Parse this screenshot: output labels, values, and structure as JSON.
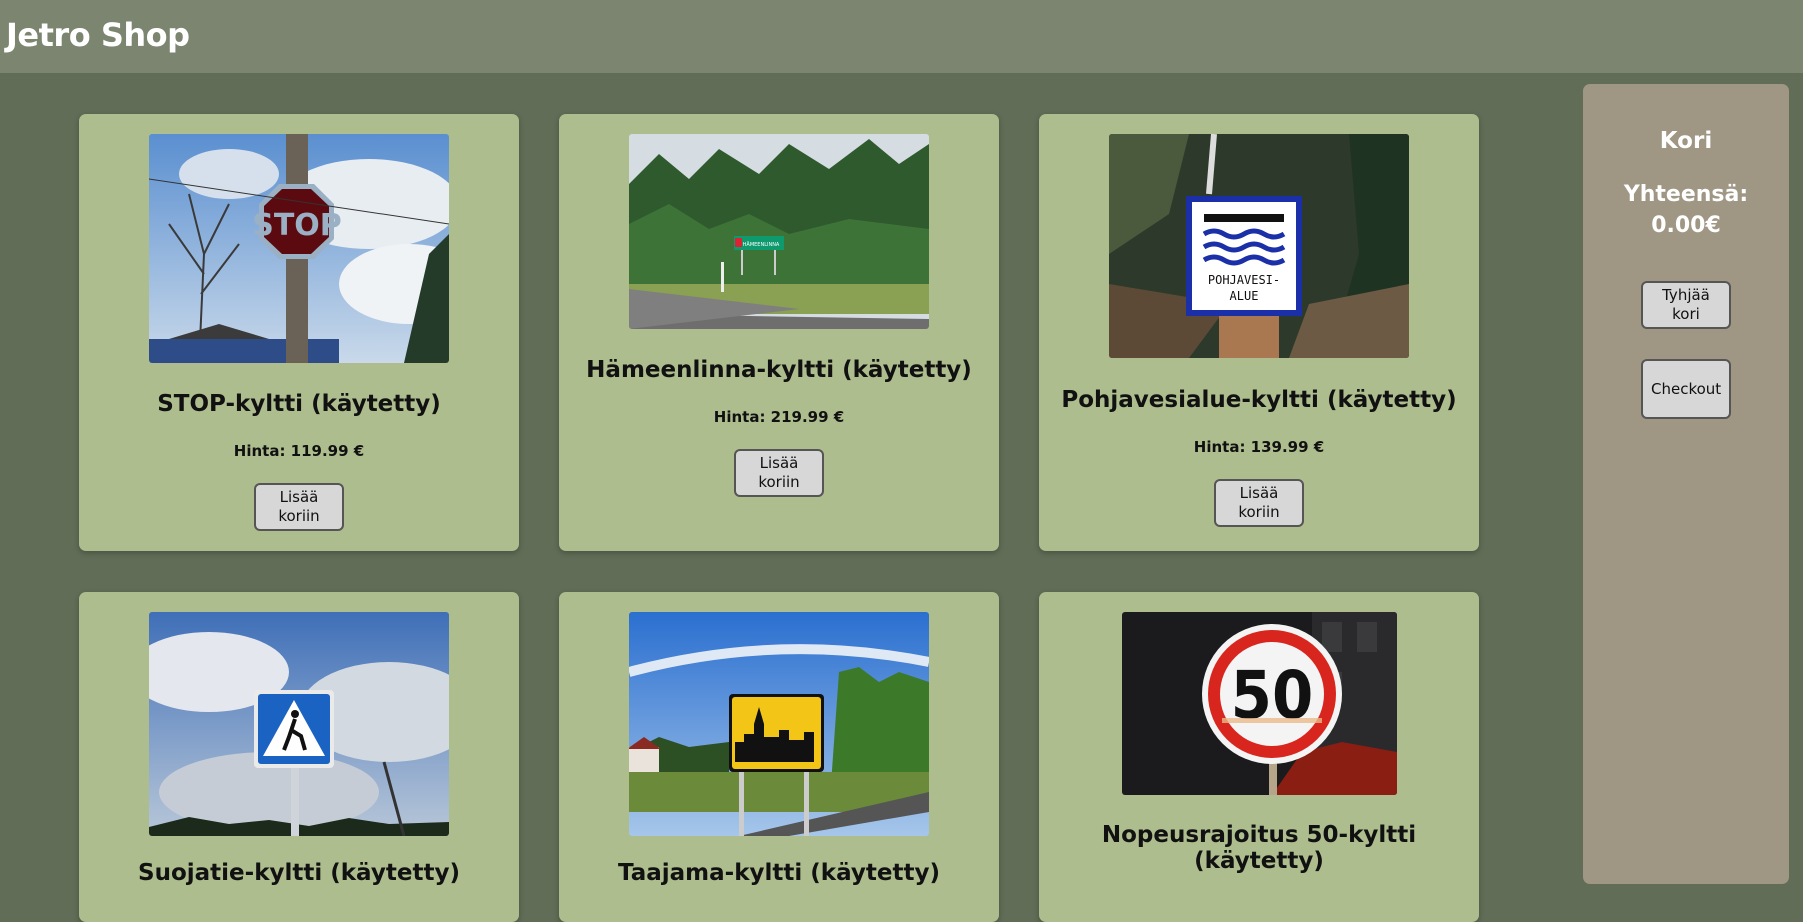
{
  "header": {
    "title": "Jetro Shop"
  },
  "products": [
    {
      "title": "STOP-kyltti (käytetty)",
      "price": "Hinta: 119.99 €",
      "button": "Lisää koriin",
      "image_icon": "stop-sign-image"
    },
    {
      "title": "Hämeenlinna-kyltti (käytetty)",
      "price": "Hinta: 219.99 €",
      "button": "Lisää koriin",
      "image_icon": "hameenlinna-sign-image"
    },
    {
      "title": "Pohjavesialue-kyltti (käytetty)",
      "price": "Hinta: 139.99 €",
      "button": "Lisää koriin",
      "image_icon": "groundwater-sign-image"
    },
    {
      "title": "Suojatie-kyltti (käytetty)",
      "image_icon": "crosswalk-sign-image"
    },
    {
      "title": "Taajama-kyltti (käytetty)",
      "image_icon": "town-sign-image"
    },
    {
      "title": "Nopeusrajoitus 50-kyltti (käytetty)",
      "image_icon": "speed-limit-50-sign-image"
    }
  ],
  "signs": {
    "stop": "STOP",
    "hameenlinna": "HÄMEENLINNA",
    "groundwater_line1": "POHJAVESI-",
    "groundwater_line2": "ALUE",
    "speed": "50"
  },
  "cart": {
    "title": "Kori",
    "total_label": "Yhteensä:",
    "total_value": "0.00€",
    "empty_button": "Tyhjää kori",
    "checkout_button": "Checkout"
  },
  "colors": {
    "background": "#616d57",
    "header": "#7b8570",
    "card": "#adbd8e",
    "cart_panel": "#9f9684",
    "button": "#d7d7d7"
  }
}
